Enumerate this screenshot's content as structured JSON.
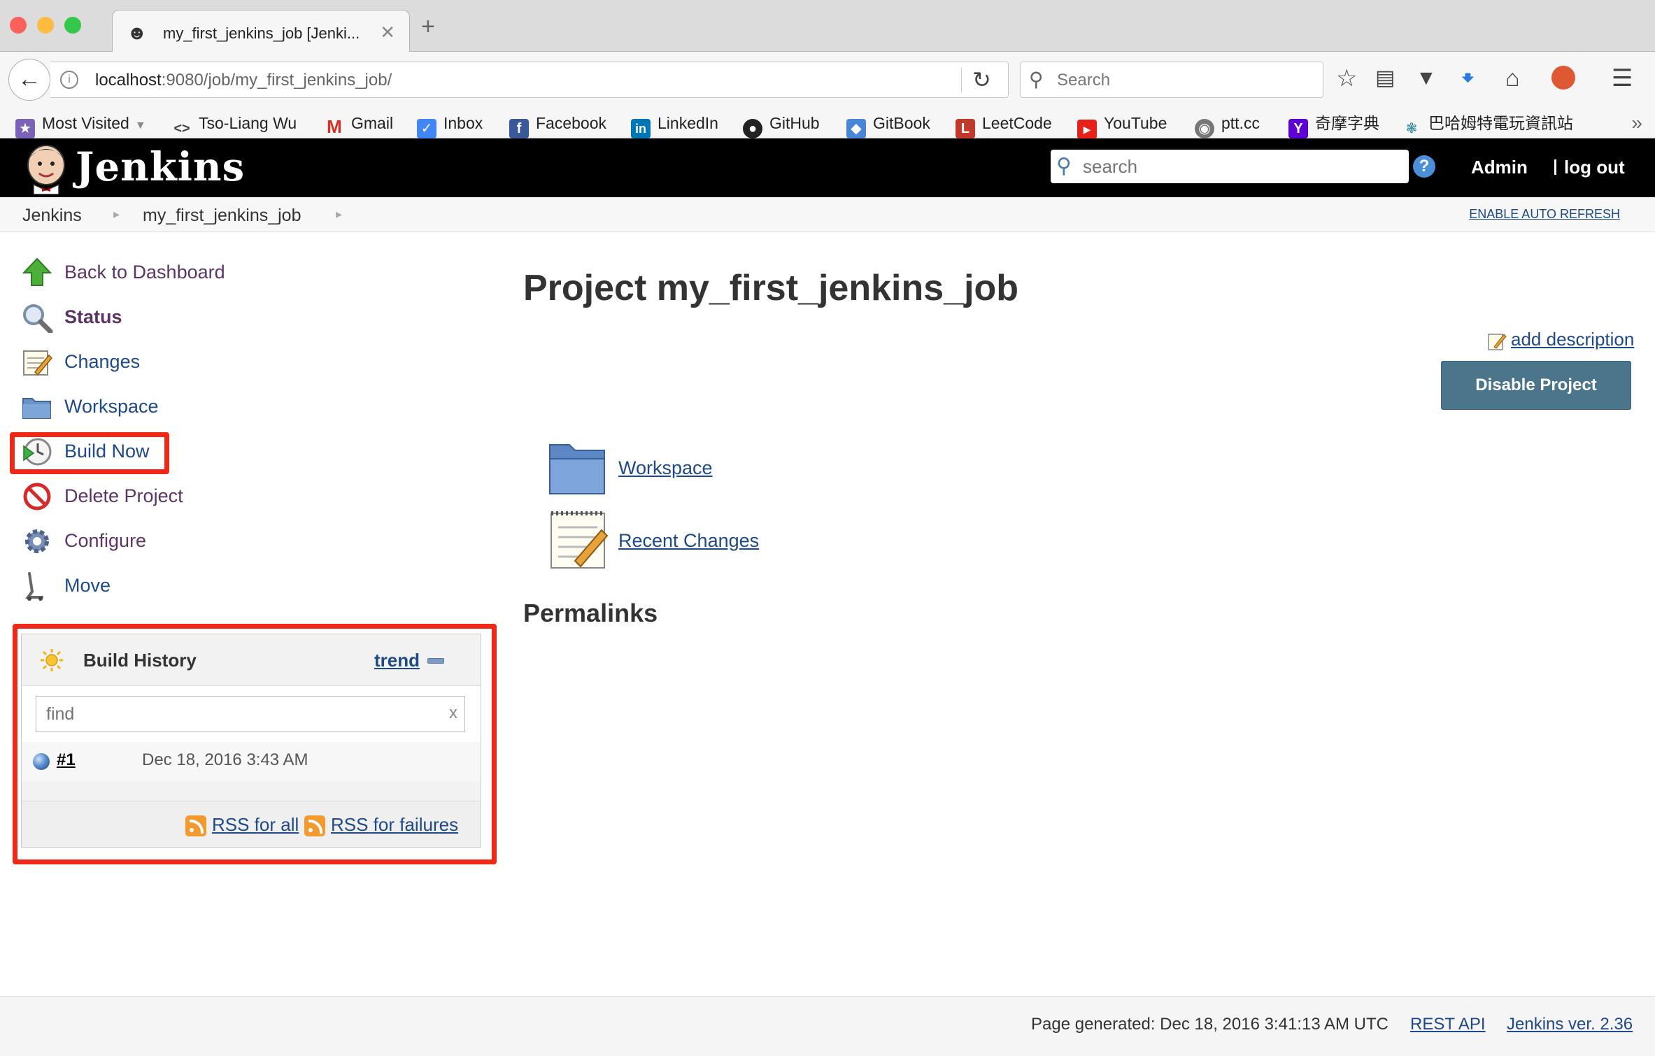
{
  "browser": {
    "tab_title": "my_first_jenkins_job [Jenki...",
    "new_tab": "+",
    "url_host": "localhost",
    "url_path": ":9080/job/my_first_jenkins_job/",
    "search_placeholder": "Search",
    "bookmarks": [
      {
        "label": "Most Visited",
        "icon": "most-visited-icon",
        "color": "#7a62b8"
      },
      {
        "label": "Tso-Liang Wu",
        "icon": "code-icon",
        "color": "#444444"
      },
      {
        "label": "Gmail",
        "icon": "gmail-icon",
        "color": "#d93025"
      },
      {
        "label": "Inbox",
        "icon": "inbox-icon",
        "color": "#4285f4"
      },
      {
        "label": "Facebook",
        "icon": "facebook-icon",
        "color": "#3b5998"
      },
      {
        "label": "LinkedIn",
        "icon": "linkedin-icon",
        "color": "#0077b5"
      },
      {
        "label": "GitHub",
        "icon": "github-icon",
        "color": "#222222"
      },
      {
        "label": "GitBook",
        "icon": "gitbook-icon",
        "color": "#4a86d8"
      },
      {
        "label": "LeetCode",
        "icon": "leetcode-icon",
        "color": "#c0392b"
      },
      {
        "label": "YouTube",
        "icon": "youtube-icon",
        "color": "#e62117"
      },
      {
        "label": "ptt.cc",
        "icon": "globe-icon",
        "color": "#777777"
      },
      {
        "label": "奇摩字典",
        "icon": "yahoo-icon",
        "color": "#5f01d1"
      },
      {
        "label": "巴哈姆特電玩資訊站",
        "icon": "bahamut-icon",
        "color": "#3b8c9e"
      }
    ]
  },
  "jenkins": {
    "logo_text": "Jenkins",
    "search_placeholder": "search",
    "help": "?",
    "admin": "Admin",
    "logout": "log out"
  },
  "breadcrumb": {
    "items": [
      "Jenkins",
      "my_first_jenkins_job"
    ],
    "auto_refresh": "ENABLE AUTO REFRESH"
  },
  "sidebar": {
    "tasks": [
      {
        "label": "Back to Dashboard",
        "icon": "up-arrow-icon"
      },
      {
        "label": "Status",
        "icon": "magnifier-icon"
      },
      {
        "label": "Changes",
        "icon": "notepad-icon"
      },
      {
        "label": "Workspace",
        "icon": "folder-icon"
      },
      {
        "label": "Build Now",
        "icon": "clock-play-icon"
      },
      {
        "label": "Delete Project",
        "icon": "no-entry-icon"
      },
      {
        "label": "Configure",
        "icon": "gear-icon"
      },
      {
        "label": "Move",
        "icon": "move-icon"
      }
    ]
  },
  "build_history": {
    "title": "Build History",
    "trend": "trend",
    "find_placeholder": "find",
    "clear": "x",
    "builds": [
      {
        "number": "#1",
        "date": "Dec 18, 2016 3:43 AM",
        "status_color": "#5b8fcf"
      }
    ],
    "rss_all": "RSS for all",
    "rss_failures": "RSS for failures"
  },
  "main": {
    "title": "Project my_first_jenkins_job",
    "add_description": "add description",
    "disable_button": "Disable Project",
    "links": [
      {
        "label": "Workspace",
        "icon": "folder-icon"
      },
      {
        "label": "Recent Changes",
        "icon": "notepad-icon"
      }
    ],
    "permalinks_heading": "Permalinks"
  },
  "footer": {
    "generated": "Page generated: Dec 18, 2016 3:41:13 AM UTC",
    "rest_api": "REST API",
    "version": "Jenkins ver. 2.36"
  },
  "colors": {
    "highlight": "#f02818",
    "link": "#204a87",
    "disable_button": "#4b758b"
  }
}
